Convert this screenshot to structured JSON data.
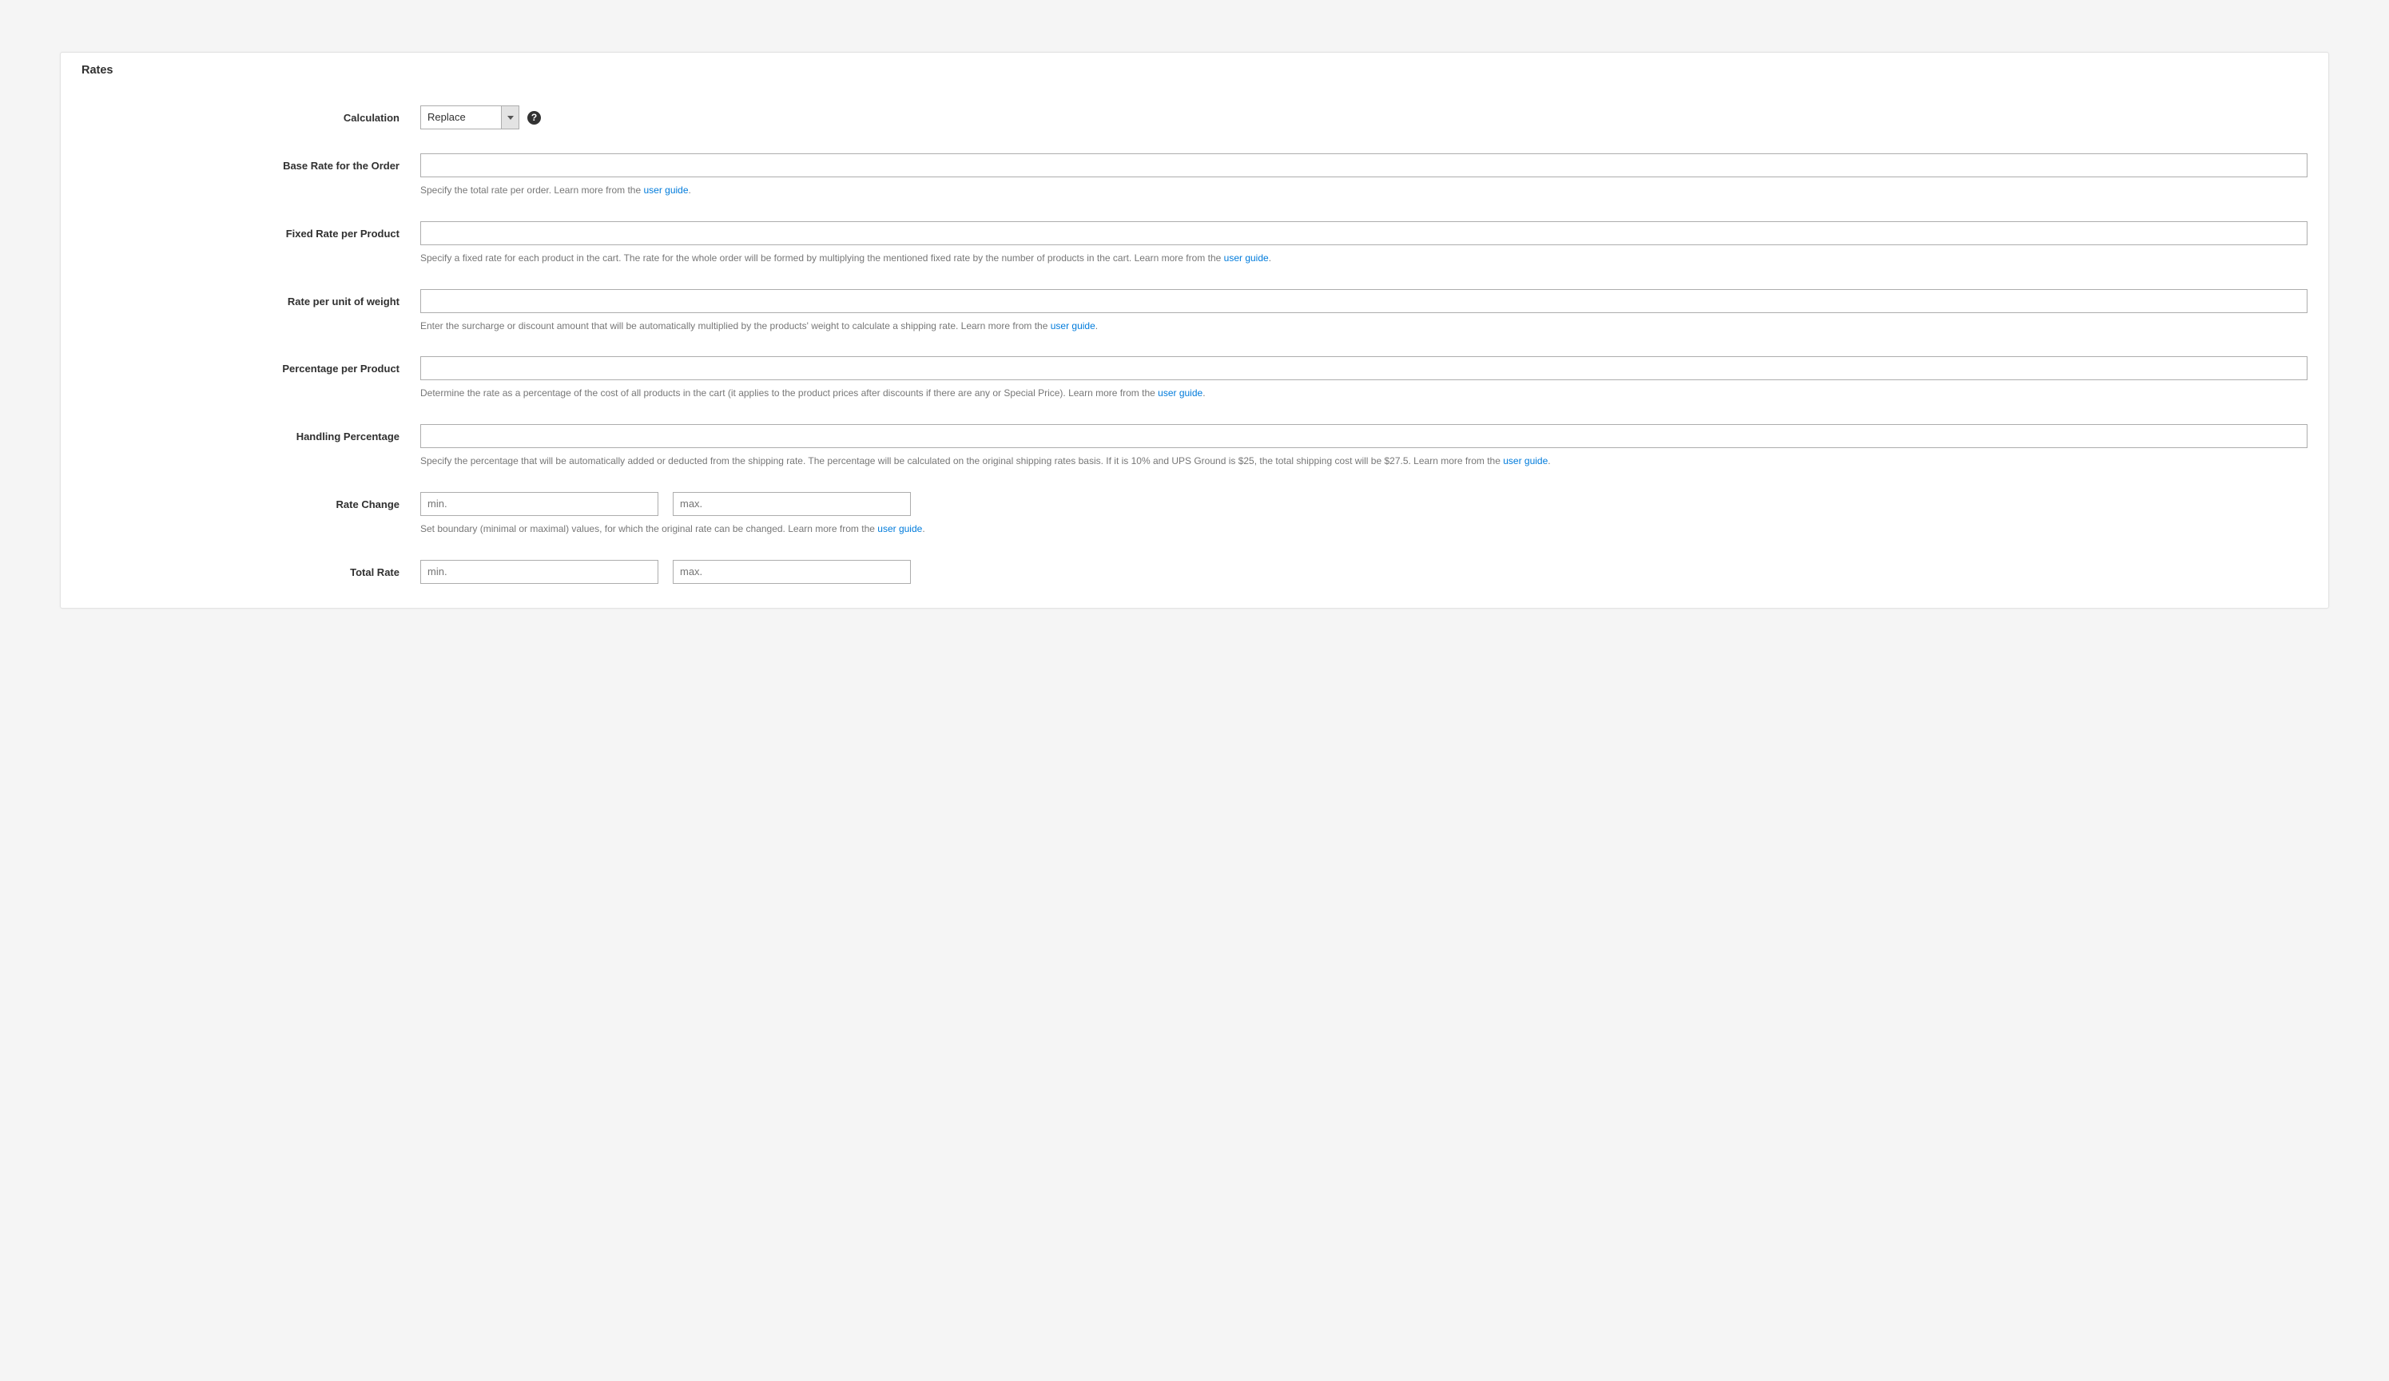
{
  "panel_title": "Rates",
  "link_text": "user guide",
  "fields": {
    "calculation": {
      "label": "Calculation",
      "value": "Replace"
    },
    "base_rate": {
      "label": "Base Rate for the Order",
      "hint": "Specify the total rate per order. Learn more from the "
    },
    "fixed_rate": {
      "label": "Fixed Rate per Product",
      "hint": "Specify a fixed rate for each product in the cart. The rate for the whole order will be formed by multiplying the mentioned fixed rate by the number of products in the cart. Learn more from the "
    },
    "rate_weight": {
      "label": "Rate per unit of weight",
      "hint": "Enter the surcharge or discount amount that will be automatically multiplied by the products' weight to calculate a shipping rate. Learn more from the "
    },
    "pct_product": {
      "label": "Percentage per Product",
      "hint": "Determine the rate as a percentage of the cost of all products in the cart (it applies to the product prices after discounts if there are any or Special Price). Learn more from the "
    },
    "handling": {
      "label": "Handling Percentage",
      "hint": "Specify the percentage that will be automatically added or deducted from the shipping rate. The percentage will be calculated on the original shipping rates basis. If it is 10% and UPS Ground is $25, the total shipping cost will be $27.5. Learn more from the "
    },
    "rate_change": {
      "label": "Rate Change",
      "min_ph": "min.",
      "max_ph": "max.",
      "hint": "Set boundary (minimal or maximal) values, for which the original rate can be changed. Learn more from the "
    },
    "total_rate": {
      "label": "Total Rate",
      "min_ph": "min.",
      "max_ph": "max."
    }
  }
}
